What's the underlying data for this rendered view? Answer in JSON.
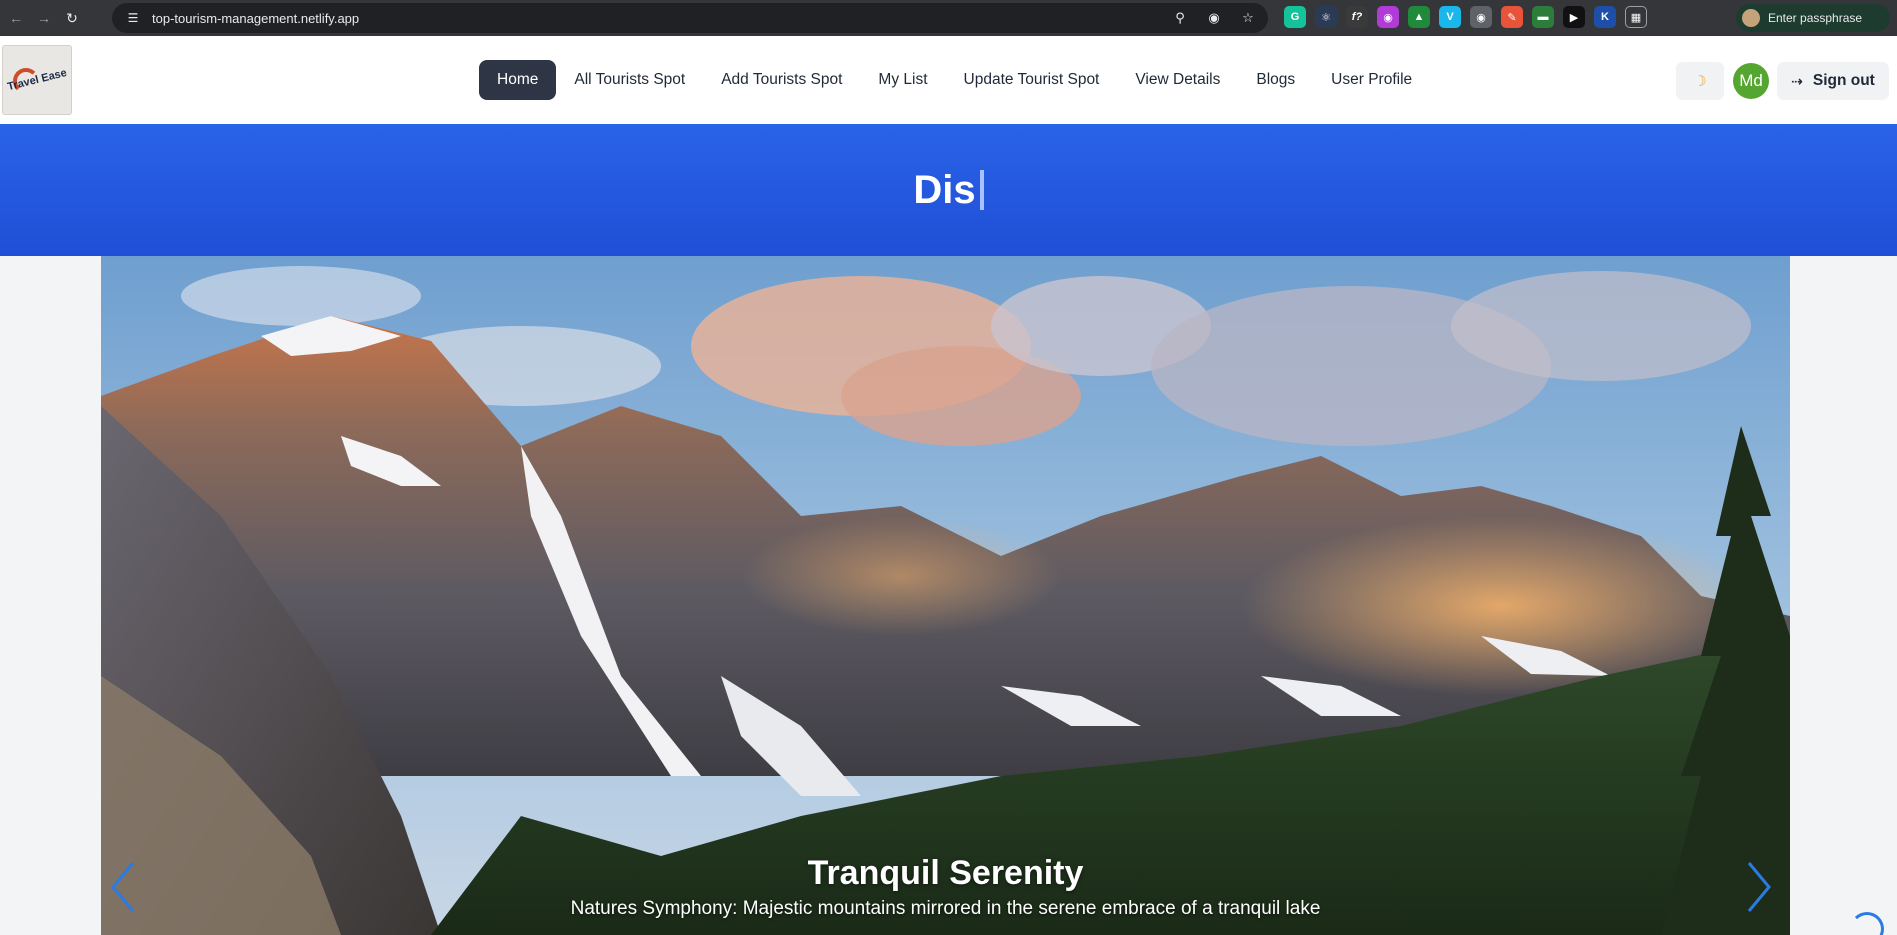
{
  "browser": {
    "url": "top-tourism-management.netlify.app",
    "profile_label": "Enter passphrase"
  },
  "navbar": {
    "logo_text": "Travel Ease",
    "links": [
      {
        "label": "Home",
        "active": true
      },
      {
        "label": "All Tourists Spot"
      },
      {
        "label": "Add Tourists Spot"
      },
      {
        "label": "My List"
      },
      {
        "label": "Update Tourist Spot"
      },
      {
        "label": "View Details"
      },
      {
        "label": "Blogs"
      },
      {
        "label": "User Profile"
      }
    ],
    "theme_icon": "moon-icon",
    "avatar_initials": "Md",
    "signout_label": "Sign out"
  },
  "hero": {
    "typed_text": "Dis"
  },
  "carousel": {
    "slide_title": "Tranquil Serenity",
    "slide_subtitle": "Natures Symphony: Majestic mountains mirrored in the serene embrace of a tranquil lake"
  },
  "colors": {
    "hero_blue": "#2a63e8",
    "nav_active": "#2e3646",
    "avatar_green": "#55a630",
    "arrow_blue": "#2a7be4"
  }
}
